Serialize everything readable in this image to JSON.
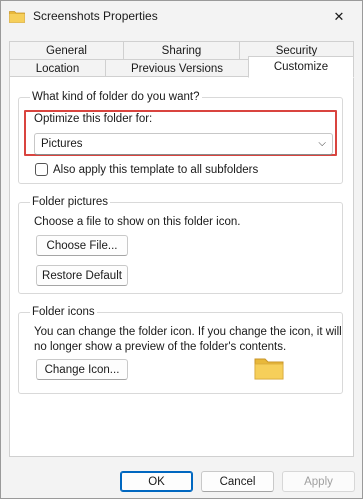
{
  "window": {
    "title": "Screenshots Properties",
    "close_glyph": "✕",
    "icon": "folder-icon"
  },
  "tabs": {
    "row1": [
      {
        "label": "General"
      },
      {
        "label": "Sharing"
      },
      {
        "label": "Security"
      }
    ],
    "row2": [
      {
        "label": "Location"
      },
      {
        "label": "Previous Versions"
      },
      {
        "label": "Customize",
        "active": true
      }
    ]
  },
  "customize": {
    "kind_group_label": "What kind of folder do you want?",
    "optimize_label": "Optimize this folder for:",
    "optimize_value": "Pictures",
    "optimize_chevron": "⌵",
    "apply_subfolders_label": "Also apply this template to all subfolders",
    "apply_subfolders_checked": false,
    "pictures_group_label": "Folder pictures",
    "pictures_help": "Choose a file to show on this folder icon.",
    "choose_file_button": "Choose File...",
    "restore_default_button": "Restore Default",
    "icons_group_label": "Folder icons",
    "icons_help_line1": "You can change the folder icon. If you change the icon, it will",
    "icons_help_line2": "no longer show a preview of the folder's contents.",
    "change_icon_button": "Change Icon..."
  },
  "footer": {
    "ok": "OK",
    "cancel": "Cancel",
    "apply": "Apply"
  },
  "colors": {
    "highlight": "#d9443f",
    "accent": "#0067c0",
    "folder": "#f4c542"
  }
}
